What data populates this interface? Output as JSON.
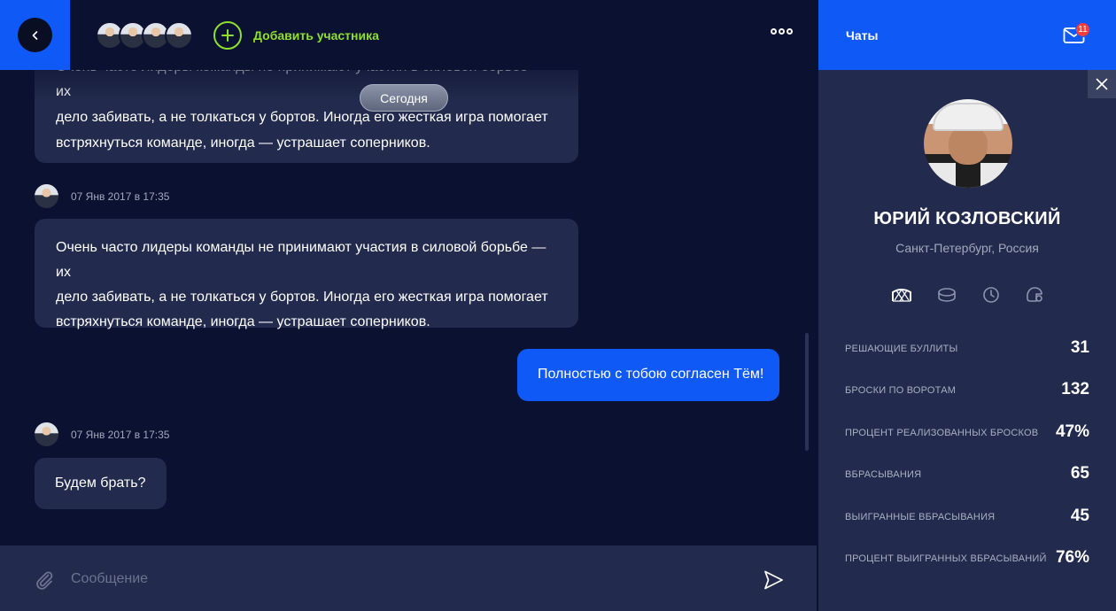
{
  "header": {
    "add_participant_label": "Добавить участника"
  },
  "chat": {
    "date_badge": "Сегодня",
    "messages": [
      {
        "text_lines": [
          "Очень часто лидеры команды не принимают участия в силовой борьбе — их",
          "дело забивать, а не толкаться у бортов. Иногда его жесткая игра помогает",
          "встряхнуться команде, иногда — устрашает соперников."
        ]
      },
      {
        "timestamp": "07 Янв 2017 в 17:35",
        "text_lines": [
          "Очень часто лидеры команды не принимают участия в силовой борьбе — их",
          "дело забивать, а не толкаться у бортов. Иногда его жесткая игра помогает",
          "встряхнуться команде, иногда — устрашает соперников."
        ]
      },
      {
        "text": "Полностью с тобою согласен Тём!"
      },
      {
        "timestamp": "07 Янв 2017 в 17:35",
        "text": "Будем брать?"
      }
    ]
  },
  "composer": {
    "placeholder": "Сообщение"
  },
  "panel": {
    "title": "Чаты",
    "unread_count": "11",
    "profile": {
      "name": "ЮРИЙ КОЗЛОВСКИЙ",
      "location": "Санкт-Петербург, Россия"
    },
    "stat_tabs": [
      "net-icon",
      "puck-icon",
      "clock-icon",
      "helmet-icon"
    ],
    "stats": [
      {
        "label": "РЕШАЮЩИЕ БУЛЛИТЫ",
        "value": "31"
      },
      {
        "label": "БРОСКИ ПО ВОРОТАМ",
        "value": "132"
      },
      {
        "label": "ПРОЦЕНТ РЕАЛИЗОВАННЫХ БРОСКОВ",
        "value": "47%"
      },
      {
        "label": "ВБРАСЫВАНИЯ",
        "value": "65"
      },
      {
        "label": "ВЫИГРАННЫЕ ВБРАСЫВАНИЯ",
        "value": "45"
      },
      {
        "label": "ПРОЦЕНТ ВЫИГРАННЫХ ВБРАСЫВАНИЙ",
        "value": "76%"
      }
    ]
  },
  "colors": {
    "accent_blue": "#0f59f7",
    "accent_green": "#8ee02f",
    "background": "#0b1130",
    "surface": "#222a4d",
    "badge_red": "#ff3b3b"
  }
}
